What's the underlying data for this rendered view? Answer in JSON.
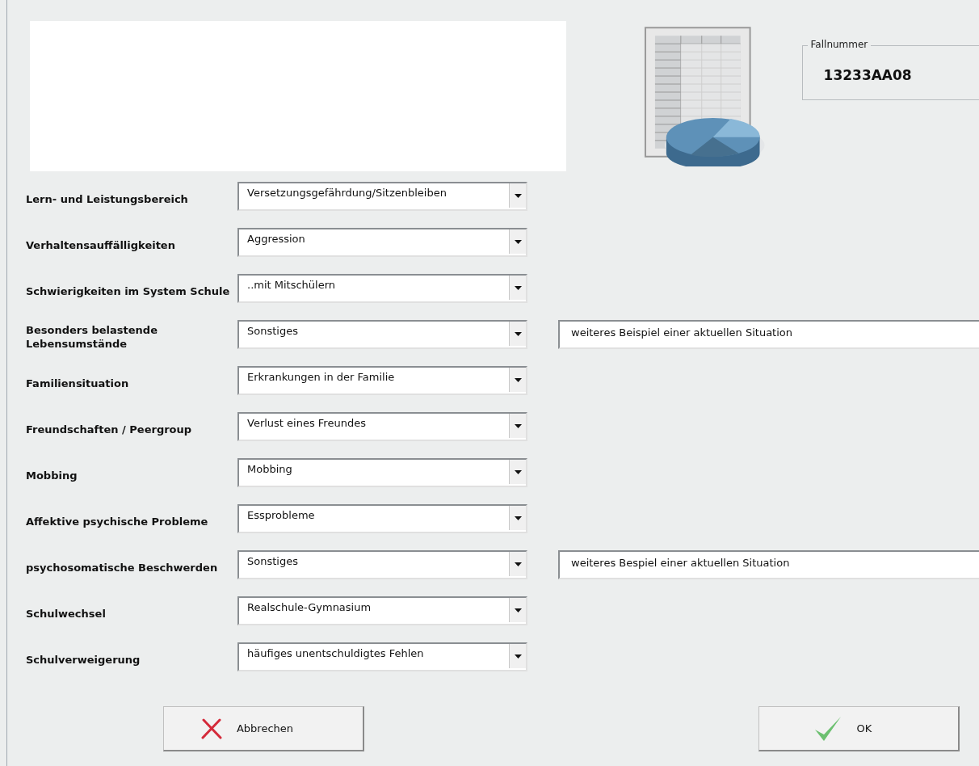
{
  "case_number": {
    "legend": "Fallnummer",
    "value": "13233AA08"
  },
  "rows": [
    {
      "label": "Lern- und Leistungsbereich",
      "value": "Versetzungsgefährdung/Sitzenbleiben"
    },
    {
      "label": "Verhaltensauffälligkeiten",
      "value": "Aggression"
    },
    {
      "label": "Schwierigkeiten im System Schule",
      "value": "..mit Mitschülern"
    },
    {
      "label": "Besonders belastende Lebensumstände",
      "value": "Sonstiges",
      "note": "weiteres Beispiel einer aktuellen Situation"
    },
    {
      "label": "Familiensituation",
      "value": "Erkrankungen in der Familie"
    },
    {
      "label": "Freundschaften / Peergroup",
      "value": "Verlust eines Freundes"
    },
    {
      "label": "Mobbing",
      "value": "Mobbing"
    },
    {
      "label": "Affektive psychische Probleme",
      "value": "Essprobleme"
    },
    {
      "label": "psychosomatische Beschwerden",
      "value": "Sonstiges",
      "note": "weiteres Bespiel einer aktuellen Situation"
    },
    {
      "label": "Schulwechsel",
      "value": "Realschule-Gymnasium"
    },
    {
      "label": "Schulverweigerung",
      "value": "häufiges unentschuldigtes Fehlen"
    }
  ],
  "buttons": [
    {
      "kind": "cancel",
      "label": "Abbrechen"
    },
    {
      "kind": "ok",
      "label": "OK"
    }
  ]
}
